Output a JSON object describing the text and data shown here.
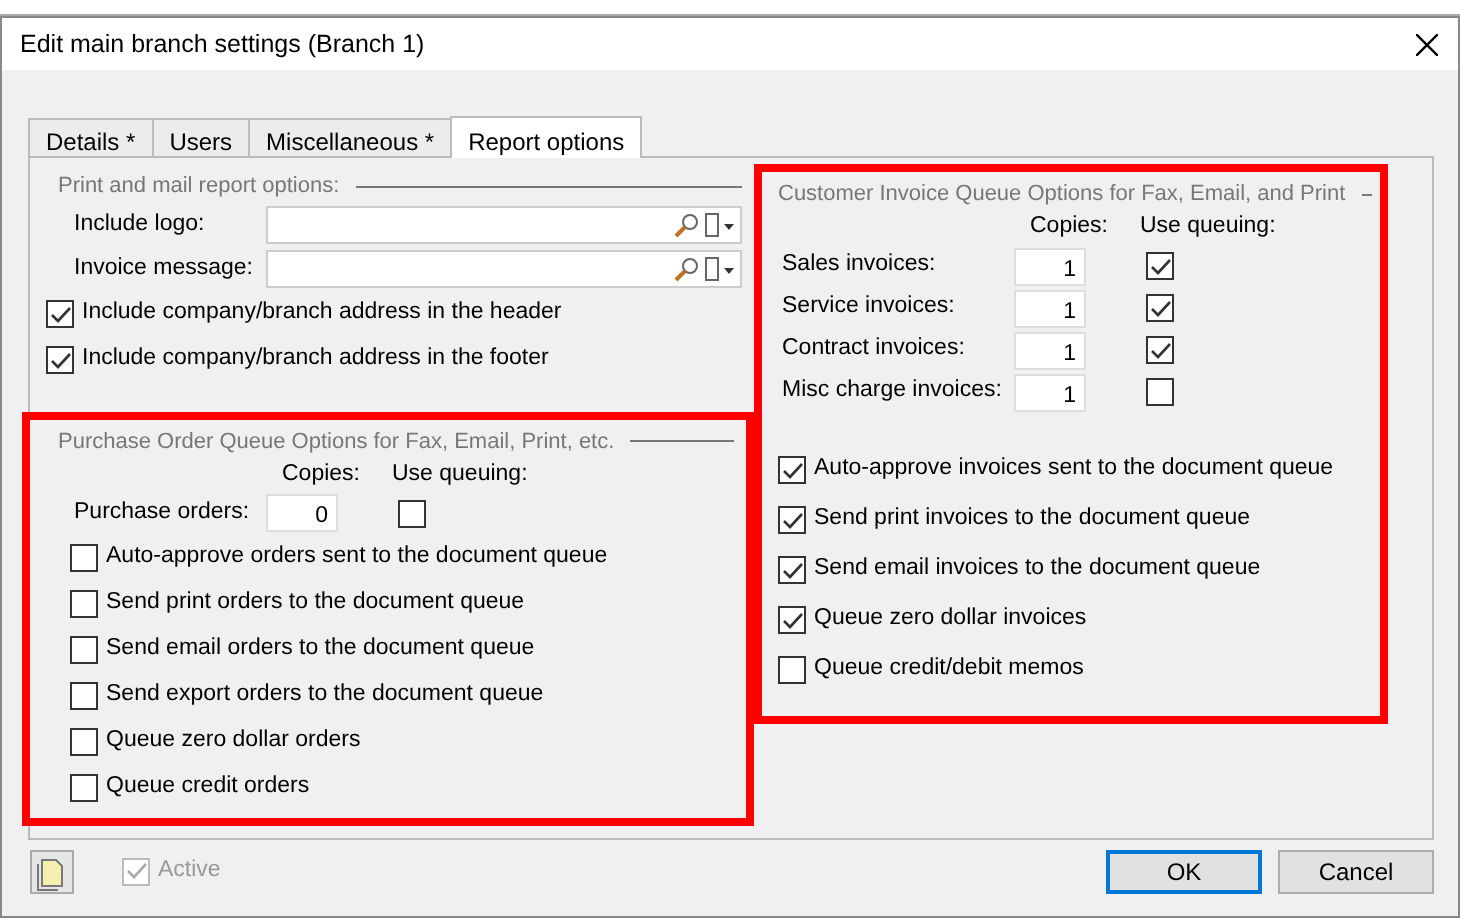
{
  "window": {
    "title": "Edit main branch settings (Branch 1)"
  },
  "tabs": [
    {
      "label": "Details *",
      "selected": false
    },
    {
      "label": "Users",
      "selected": false
    },
    {
      "label": "Miscellaneous *",
      "selected": false
    },
    {
      "label": "Report options",
      "selected": true
    }
  ],
  "print_mail": {
    "title": "Print and mail report options:",
    "fields": [
      {
        "label": "Include logo:"
      },
      {
        "label": "Invoice message:"
      }
    ],
    "options": [
      {
        "label": "Include company/branch address in the header",
        "checked": true
      },
      {
        "label": "Include company/branch address in the footer",
        "checked": true
      }
    ]
  },
  "purchase_orders": {
    "title": "Purchase Order Queue Options for Fax, Email, Print, etc.",
    "highlighted": true,
    "copies_header": "Copies:",
    "queuing_header": "Use queuing:",
    "rows": [
      {
        "label": "Purchase orders:",
        "copies": "0",
        "use_queuing": false
      }
    ],
    "options": [
      {
        "label": "Auto-approve orders sent to the document queue",
        "checked": false
      },
      {
        "label": "Send print orders to the document queue",
        "checked": false
      },
      {
        "label": "Send email orders to the document queue",
        "checked": false
      },
      {
        "label": "Send export orders to the document queue",
        "checked": false
      },
      {
        "label": "Queue zero dollar orders",
        "checked": false
      },
      {
        "label": "Queue credit orders",
        "checked": false
      }
    ]
  },
  "customer_invoices": {
    "title": "Customer Invoice Queue Options for Fax, Email, and Print",
    "highlighted": true,
    "copies_header": "Copies:",
    "queuing_header": "Use queuing:",
    "rows": [
      {
        "label": "Sales invoices:",
        "copies": "1",
        "use_queuing": true
      },
      {
        "label": "Service invoices:",
        "copies": "1",
        "use_queuing": true
      },
      {
        "label": "Contract invoices:",
        "copies": "1",
        "use_queuing": true
      },
      {
        "label": "Misc charge invoices:",
        "copies": "1",
        "use_queuing": false
      }
    ],
    "options": [
      {
        "label": "Auto-approve invoices sent to the document queue",
        "checked": true
      },
      {
        "label": "Send print invoices to the document queue",
        "checked": true
      },
      {
        "label": "Send email invoices to the document queue",
        "checked": true
      },
      {
        "label": "Queue zero dollar invoices",
        "checked": true
      },
      {
        "label": "Queue credit/debit memos",
        "checked": false
      }
    ]
  },
  "footer": {
    "active": {
      "label": "Active",
      "checked": true,
      "disabled": true
    },
    "buttons": [
      {
        "label": "OK",
        "default": true
      },
      {
        "label": "Cancel",
        "default": false
      }
    ]
  }
}
